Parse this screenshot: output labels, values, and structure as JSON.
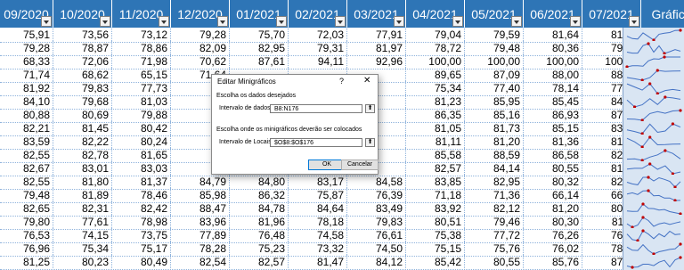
{
  "columns": [
    "09/2020",
    "10/2020",
    "11/2020",
    "12/2020",
    "01/2021",
    "02/2021",
    "03/2021",
    "04/2021",
    "05/2021",
    "06/2021",
    "07/2021",
    "Gráfico"
  ],
  "rows": [
    [
      "75,91",
      "73,56",
      "73,12",
      "79,28",
      "75,70",
      "72,03",
      "77,91",
      "79,04",
      "79,59",
      "81,64",
      "81,86"
    ],
    [
      "79,28",
      "78,87",
      "78,86",
      "82,09",
      "82,95",
      "79,31",
      "81,97",
      "78,72",
      "79,48",
      "80,36",
      "79,71"
    ],
    [
      "68,33",
      "72,06",
      "71,98",
      "70,62",
      "87,61",
      "94,11",
      "92,96",
      "100,00",
      "100,00",
      "100,00",
      "100,00"
    ],
    [
      "71,74",
      "68,62",
      "65,15",
      "71,64",
      "",
      "",
      "",
      "89,65",
      "87,09",
      "88,00",
      "88,24"
    ],
    [
      "81,92",
      "79,83",
      "77,73",
      "82,",
      "",
      "",
      "",
      "75,34",
      "77,40",
      "78,14",
      "77,39"
    ],
    [
      "84,10",
      "79,68",
      "81,03",
      "85,",
      "",
      "",
      "",
      "81,23",
      "85,95",
      "85,45",
      "84,58"
    ],
    [
      "80,88",
      "80,69",
      "79,88",
      "85,",
      "",
      "",
      "",
      "86,35",
      "85,16",
      "86,93",
      "87,25"
    ],
    [
      "82,21",
      "81,45",
      "80,42",
      "85,",
      "",
      "",
      "",
      "81,05",
      "81,73",
      "85,15",
      "83,60"
    ],
    [
      "83,59",
      "82,22",
      "80,24",
      "84,",
      "",
      "",
      "",
      "81,11",
      "81,20",
      "81,36",
      "81,40"
    ],
    [
      "82,55",
      "82,78",
      "81,65",
      "84,",
      "",
      "",
      "",
      "85,58",
      "88,59",
      "86,58",
      "82,75"
    ],
    [
      "82,67",
      "83,01",
      "83,03",
      "85,",
      "",
      "",
      "",
      "82,57",
      "84,14",
      "80,55",
      "81,35"
    ],
    [
      "82,55",
      "81,80",
      "81,37",
      "84,79",
      "84,80",
      "83,17",
      "84,58",
      "83,85",
      "82,95",
      "80,32",
      "82,84"
    ],
    [
      "79,48",
      "81,89",
      "78,46",
      "85,98",
      "86,32",
      "75,87",
      "76,39",
      "71,18",
      "71,36",
      "66,14",
      "66,35"
    ],
    [
      "82,65",
      "82,31",
      "82,42",
      "88,47",
      "84,78",
      "84,64",
      "83,49",
      "83,92",
      "82,12",
      "81,20",
      "80,27"
    ],
    [
      "79,80",
      "77,61",
      "78,98",
      "83,96",
      "81,96",
      "78,18",
      "79,83",
      "80,51",
      "79,46",
      "80,30",
      "81,11"
    ],
    [
      "76,53",
      "74,15",
      "73,75",
      "77,89",
      "76,48",
      "74,58",
      "76,61",
      "75,38",
      "77,72",
      "76,26",
      "76,51"
    ],
    [
      "76,96",
      "75,34",
      "75,17",
      "78,28",
      "75,23",
      "73,32",
      "74,50",
      "75,15",
      "75,76",
      "76,02",
      "78,55"
    ],
    [
      "81,25",
      "80,23",
      "80,49",
      "82,54",
      "82,57",
      "81,47",
      "84,12",
      "85,42",
      "80,55",
      "85,76",
      "87,59"
    ]
  ],
  "dialog": {
    "title": "Editar Minigráficos",
    "help": "?",
    "close": "✕",
    "section_data": "Escolha os dados desejados",
    "range_label": "Intervalo de dados:",
    "range_value": "B8:N176",
    "section_location": "Escolha onde os minigráficos deverão ser colocados",
    "location_label": "Intervalo de Locais:",
    "location_value": "$O$8:$O$176",
    "ok": "OK",
    "cancel": "Cancelar",
    "ref_icon": "collapse-range-icon"
  },
  "colors": {
    "header": "#2e75b6",
    "sparkline": "#4472c4",
    "marker": "#c00000",
    "spark_bg": "#d9e5f3"
  }
}
